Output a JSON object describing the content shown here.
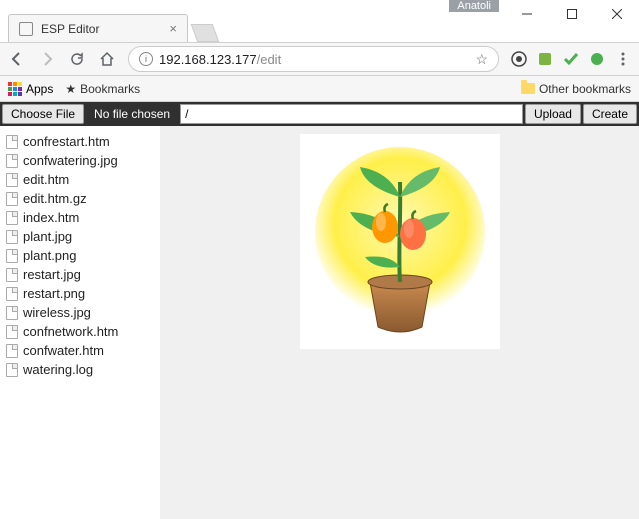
{
  "window": {
    "user_badge": "Anatoli"
  },
  "tab": {
    "title": "ESP Editor"
  },
  "omnibox": {
    "host": "192.168.123.177",
    "path": "/edit"
  },
  "bookmarks": {
    "apps": "Apps",
    "bookmarks": "Bookmarks",
    "other": "Other bookmarks"
  },
  "editor": {
    "choose_file": "Choose File",
    "no_file": "No file chosen",
    "path_value": "/",
    "upload": "Upload",
    "create": "Create"
  },
  "files": [
    "confrestart.htm",
    "confwatering.jpg",
    "edit.htm",
    "edit.htm.gz",
    "index.htm",
    "plant.jpg",
    "plant.png",
    "restart.jpg",
    "restart.png",
    "wireless.jpg",
    "confnetwork.htm",
    "confwater.htm",
    "watering.log"
  ]
}
